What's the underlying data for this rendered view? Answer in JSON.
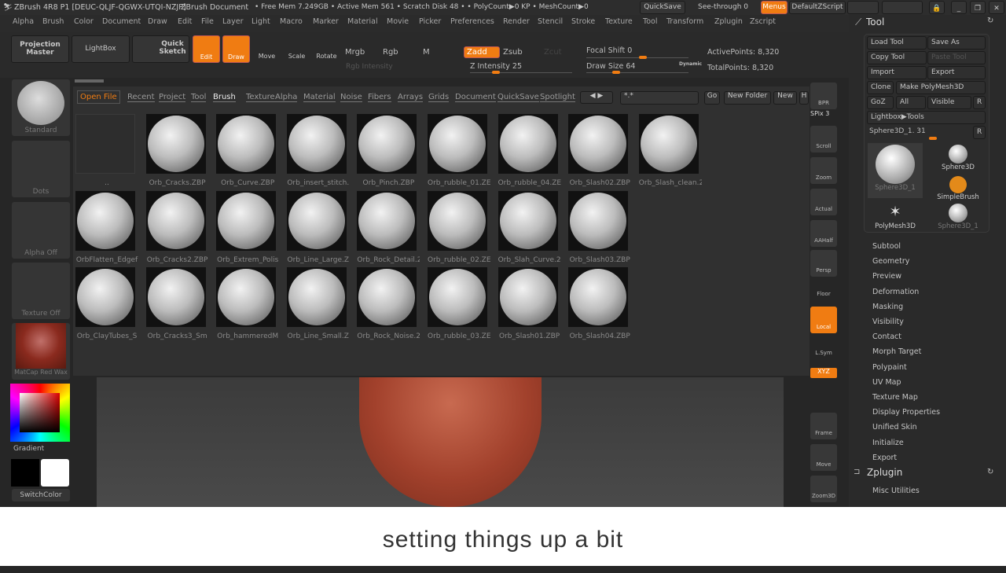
{
  "titlebar": {
    "app": "ZBrush 4R8 P1 [DEUC-QLJF-QGWX-UTQI-NZJP]",
    "doc": "ZBrush Document",
    "stats": "• Free Mem 7.249GB • Active Mem 561 • Scratch Disk 48 •  • PolyCount▶0 KP • MeshCount▶0",
    "quicksave": "QuickSave",
    "seethrough": "See-through  0",
    "menus": "Menus",
    "defaultzscript": "DefaultZScript"
  },
  "menus": [
    "Alpha",
    "Brush",
    "Color",
    "Document",
    "Draw",
    "Edit",
    "File",
    "Layer",
    "Light",
    "Macro",
    "Marker",
    "Material",
    "Movie",
    "Picker",
    "Preferences",
    "Render",
    "Stencil",
    "Stroke",
    "Texture",
    "Tool",
    "Transform",
    "Zplugin",
    "Zscript"
  ],
  "toolbar": {
    "projection_master": "Projection Master",
    "lightbox": "LightBox",
    "quick_sketch": "Quick Sketch",
    "edit": "Edit",
    "draw": "Draw",
    "move": "Move",
    "scale": "Scale",
    "rotate": "Rotate",
    "mrgb": "Mrgb",
    "rgb": "Rgb",
    "m": "M",
    "rgb_intensity": "Rgb Intensity",
    "zadd": "Zadd",
    "zsub": "Zsub",
    "zcut": "Zcut",
    "z_intensity": "Z Intensity 25",
    "focal_shift": "Focal Shift 0",
    "draw_size": "Draw Size 64",
    "dynamic": "Dynamic",
    "active_points": "ActivePoints: 8,320",
    "total_points": "TotalPoints: 8,320",
    "z_intensity_value": 25,
    "focal_shift_value": 0,
    "draw_size_value": 64
  },
  "lightbox": {
    "tabs": [
      "Open File",
      "Recent",
      "Project",
      "Tool",
      "Brush",
      "Texture",
      "Alpha",
      "Material",
      "Noise",
      "Fibers",
      "Arrays",
      "Grids",
      "Document",
      "QuickSave",
      "Spotlight"
    ],
    "active_tab": "Brush",
    "filter": "*.*",
    "go": "Go",
    "new_folder": "New Folder",
    "new": "New",
    "h": "H",
    "items": [
      "..",
      "Orb_Cracks.ZBP",
      "Orb_Curve.ZBP",
      "Orb_insert_stitch.",
      "Orb_Pinch.ZBP",
      "Orb_rubble_01.ZE",
      "Orb_rubble_04.ZE",
      "Orb_Slash02.ZBP",
      "Orb_Slash_clean.2",
      "OrbFlatten_Edgef",
      "Orb_Cracks2.ZBP",
      "Orb_Extrem_Polis",
      "Orb_Line_Large.Z",
      "Orb_Rock_Detail.2",
      "Orb_rubble_02.ZE",
      "Orb_Slah_Curve.2",
      "Orb_Slash03.ZBP",
      "Orb_ClayTubes_S",
      "Orb_Cracks3_Sm",
      "Orb_hammeredM",
      "Orb_Line_Small.Z",
      "Orb_Rock_Noise.2",
      "Orb_rubble_03.ZE",
      "Orb_Slash01.ZBP",
      "Orb_Slash04.ZBP"
    ]
  },
  "leftpanel": {
    "brush": "Standard",
    "stroke": "Dots",
    "alpha": "Alpha Off",
    "texture": "Texture Off",
    "material": "MatCap Red Wax",
    "gradient": "Gradient",
    "switchcolor": "SwitchColor",
    "main_color": "#000000",
    "secondary_color": "#ffffff"
  },
  "shelf": [
    {
      "label": "BPR"
    },
    {
      "label": "SPix 3"
    },
    {
      "label": "Scroll"
    },
    {
      "label": "Zoom"
    },
    {
      "label": "Actual"
    },
    {
      "label": "AAHalf"
    },
    {
      "label": "Persp"
    },
    {
      "label": "Floor"
    },
    {
      "label": "Local"
    },
    {
      "label": "L.Sym"
    },
    {
      "label": "XYZ"
    },
    {
      "label": "Frame"
    },
    {
      "label": "Move"
    },
    {
      "label": "Zoom3D"
    }
  ],
  "toolpanel": {
    "title": "Tool",
    "load": "Load Tool",
    "save_as": "Save As",
    "copy": "Copy Tool",
    "paste": "Paste Tool",
    "import": "Import",
    "export": "Export",
    "clone": "Clone",
    "make_polymesh": "Make PolyMesh3D",
    "goz": "GoZ",
    "all": "All",
    "visible": "Visible",
    "r": "R",
    "lightbox_tools": "Lightbox▶Tools",
    "current_tool": "Sphere3D_1. 31",
    "tools": [
      "Sphere3D_1",
      "Sphere3D",
      "SimpleBrush",
      "PolyMesh3D",
      "Sphere3D_1"
    ],
    "subpalettes": [
      "Subtool",
      "Geometry",
      "Preview",
      "Deformation",
      "Masking",
      "Visibility",
      "Contact",
      "Morph Target",
      "Polypaint",
      "UV Map",
      "Texture Map",
      "Display Properties",
      "Unified Skin",
      "Initialize",
      "Export"
    ],
    "zplugin": "Zplugin",
    "misc": "Misc Utilities"
  },
  "caption": "setting things up a bit",
  "colors": {
    "accent": "#f07c12",
    "bg": "#262626"
  }
}
